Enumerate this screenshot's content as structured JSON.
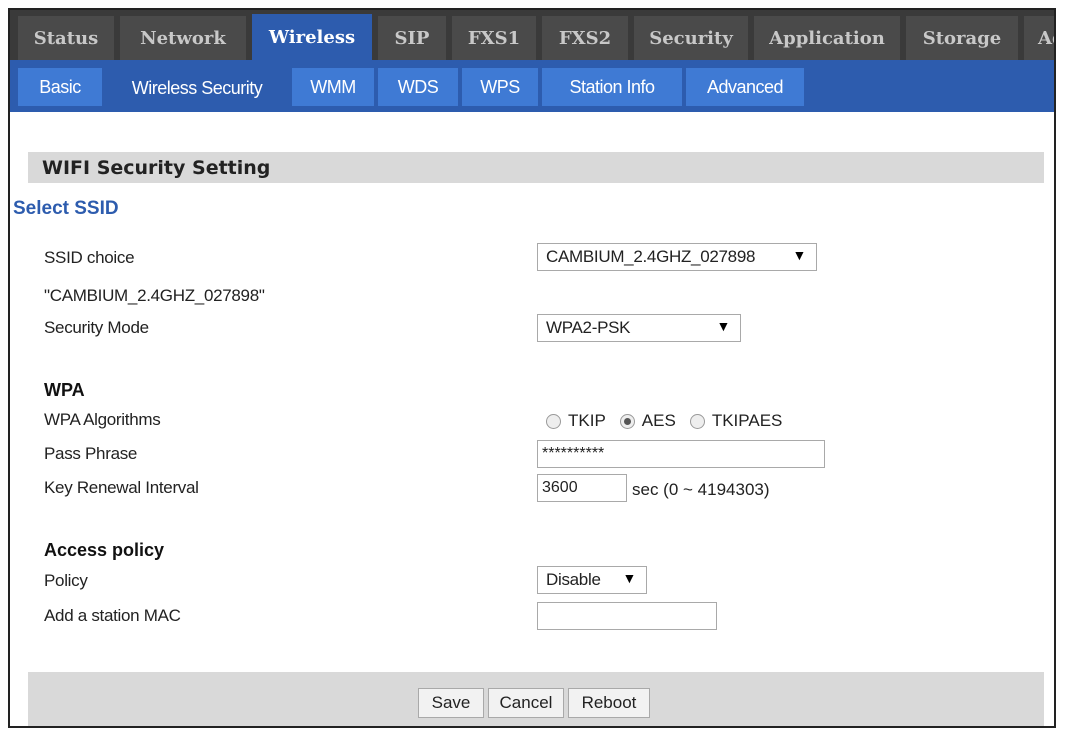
{
  "top_tabs": [
    "Status",
    "Network",
    "Wireless",
    "SIP",
    "FXS1",
    "FXS2",
    "Security",
    "Application",
    "Storage",
    "Ad"
  ],
  "sub_tabs": [
    "Basic",
    "Wireless Security",
    "WMM",
    "WDS",
    "WPS",
    "Station Info",
    "Advanced"
  ],
  "section_title": "WIFI Security Setting",
  "select_ssid_label": "Select SSID",
  "ssid_choice": {
    "label": "SSID choice",
    "value": "CAMBIUM_2.4GHZ_027898"
  },
  "ssid_quoted": "\"CAMBIUM_2.4GHZ_027898\"",
  "security_mode": {
    "label": "Security Mode",
    "value": "WPA2-PSK"
  },
  "wpa": {
    "heading": "WPA",
    "algorithms_label": "WPA Algorithms",
    "algorithms": [
      "TKIP",
      "AES",
      "TKIPAES"
    ],
    "algorithm_selected": "AES",
    "pass_phrase_label": "Pass Phrase",
    "pass_phrase_value": "**********",
    "key_renewal_label": "Key Renewal Interval",
    "key_renewal_value": "3600",
    "key_renewal_unit": "sec  (0 ~ 4194303)"
  },
  "access_policy": {
    "heading": "Access policy",
    "policy_label": "Policy",
    "policy_value": "Disable",
    "add_mac_label": "Add a station MAC",
    "add_mac_value": ""
  },
  "buttons": {
    "save": "Save",
    "cancel": "Cancel",
    "reboot": "Reboot"
  },
  "icons": {
    "dropdown": "caret-down-icon",
    "radio": "radio-icon"
  },
  "colors": {
    "active_tab": "#2d5cae",
    "sub_tab": "#3f7ad4",
    "top_bar": "#3a3a3a",
    "section_bg": "#d9d9d9"
  }
}
